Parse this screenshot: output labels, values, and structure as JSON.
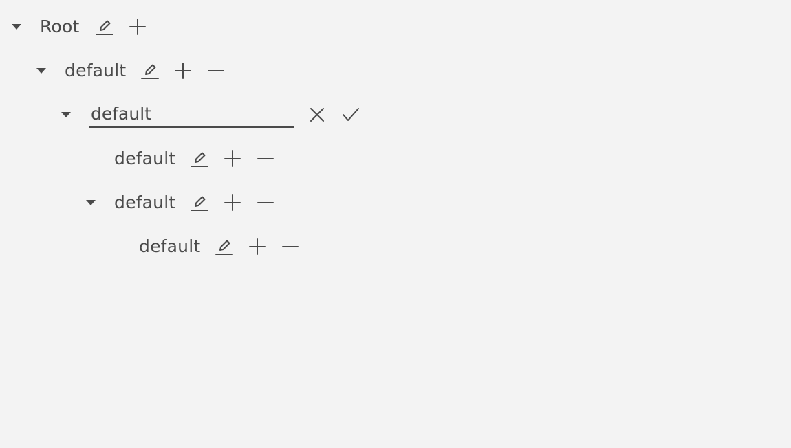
{
  "tree": {
    "root": {
      "label": "Root"
    },
    "level1": {
      "label": "default"
    },
    "editing": {
      "value": "default"
    },
    "child_a": {
      "label": "default"
    },
    "child_b": {
      "label": "default"
    },
    "grandchild": {
      "label": "default"
    }
  },
  "icons": {
    "expand": "caret-down-icon",
    "edit": "pencil-icon",
    "add": "plus-icon",
    "remove": "minus-icon",
    "cancel": "close-icon",
    "confirm": "check-icon"
  },
  "colors": {
    "background": "#f3f3f3",
    "text": "#4a4a4a"
  }
}
